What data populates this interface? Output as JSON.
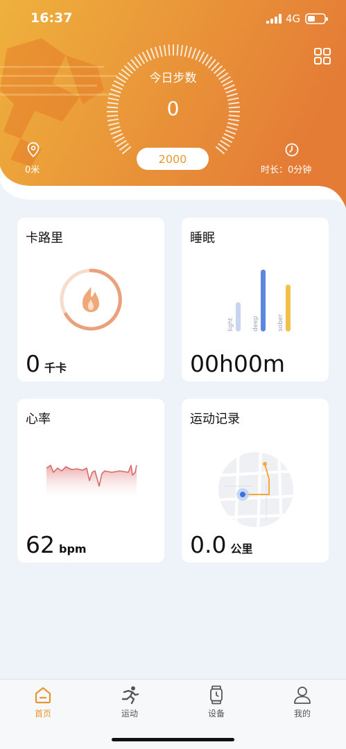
{
  "status": {
    "time": "16:37",
    "network": "4G",
    "signal_icon": "signal-bars-icon",
    "battery_icon": "battery-icon"
  },
  "header": {
    "steps_label": "今日步数",
    "steps_value": "0",
    "goal": "2000",
    "distance": "0米",
    "duration": "时长：0分钟",
    "grid_icon": "grid-menu-icon",
    "accent_start": "#f0b43a",
    "accent_end": "#e47e35"
  },
  "cards": {
    "calories": {
      "title": "卡路里",
      "value": "0",
      "unit": "千卡",
      "icon": "flame-icon"
    },
    "sleep": {
      "title": "睡眠",
      "value": "00h00m",
      "bars": [
        {
          "label": "light",
          "level": 0.45,
          "color": "#c9d4ee"
        },
        {
          "label": "deep",
          "level": 0.95,
          "color": "#5b87e0"
        },
        {
          "label": "sober",
          "level": 0.72,
          "color": "#f3c14b"
        }
      ]
    },
    "heart": {
      "title": "心率",
      "value": "62",
      "unit": "bpm"
    },
    "exercise": {
      "title": "运动记录",
      "value": "0.0",
      "unit": "公里",
      "map_icon": "route-map-icon"
    }
  },
  "nav": [
    {
      "label": "首页",
      "icon": "home-icon",
      "active": true
    },
    {
      "label": "运动",
      "icon": "running-icon",
      "active": false
    },
    {
      "label": "设备",
      "icon": "watch-icon",
      "active": false
    },
    {
      "label": "我的",
      "icon": "user-icon",
      "active": false
    }
  ],
  "colors": {
    "orange": "#e89530",
    "page_bg": "#eef2f9",
    "card_bg": "#ffffff"
  }
}
